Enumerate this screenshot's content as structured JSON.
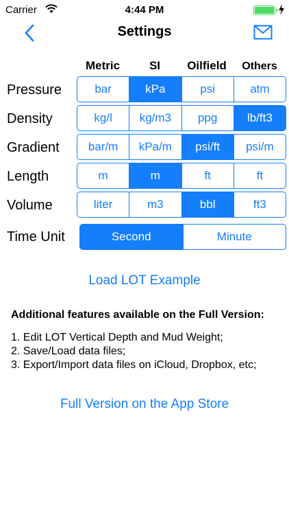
{
  "status_bar": {
    "carrier": "Carrier",
    "time": "4:44 PM",
    "battery_color": "#4cd964"
  },
  "nav": {
    "title": "Settings",
    "back_icon": "chevron-left-icon",
    "mail_icon": "mail-icon"
  },
  "accent_color": "#147efb",
  "columns": {
    "metric": "Metric",
    "si": "SI",
    "oilfield": "Oilfield",
    "others": "Others"
  },
  "units": [
    {
      "label": "Pressure",
      "options": [
        "bar",
        "kPa",
        "psi",
        "atm"
      ],
      "selected": "kPa"
    },
    {
      "label": "Density",
      "options": [
        "kg/l",
        "kg/m3",
        "ppg",
        "lb/ft3"
      ],
      "selected": "lb/ft3"
    },
    {
      "label": "Gradient",
      "options": [
        "bar/m",
        "kPa/m",
        "psi/ft",
        "psi/m"
      ],
      "selected": "psi/ft"
    },
    {
      "label": "Length",
      "options": [
        "m",
        "m",
        "ft",
        "ft"
      ],
      "selected_index": 1
    },
    {
      "label": "Volume",
      "options": [
        "liter",
        "m3",
        "bbl",
        "ft3"
      ],
      "selected": "bbl"
    }
  ],
  "time_unit": {
    "label": "Time Unit",
    "options": [
      "Second",
      "Minute"
    ],
    "selected": "Second"
  },
  "load_lot_label": "Load LOT Example",
  "features": {
    "title": "Additional features available on the Full Version:",
    "items": [
      "1. Edit LOT Vertical Depth and Mud Weight;",
      "2. Save/Load data files;",
      "3. Export/Import data files on iCloud, Dropbox, etc;"
    ]
  },
  "full_version_label": "Full Version on the App Store"
}
